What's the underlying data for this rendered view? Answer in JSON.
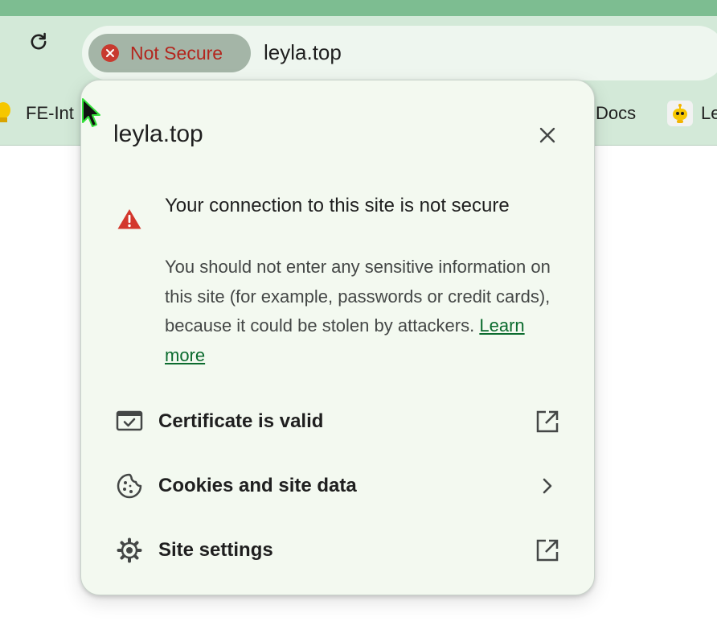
{
  "browser": {
    "reload_icon": "reload-icon",
    "security_chip": {
      "label": "Not Secure",
      "icon": "not-secure-icon",
      "color": "#b3261e"
    },
    "url": "leyla.top",
    "accent": "#7dbd91"
  },
  "bookmarks": {
    "items": [
      {
        "label": "FE-Int",
        "icon": "lightbulb-icon"
      },
      {
        "label": "Docs"
      },
      {
        "label": "Le",
        "icon": "robot-icon"
      }
    ]
  },
  "site_info_popup": {
    "title": "leyla.top",
    "close_icon": "close-icon",
    "warning": {
      "icon": "warning-icon",
      "heading": "Your connection to this site is not secure",
      "body": "You should not enter any sensitive information on this site (for example, passwords or credit cards), because it could be stolen by attackers.",
      "link": "Learn more"
    },
    "rows": [
      {
        "label": "Certificate is valid",
        "icon": "certificate-icon",
        "trailing_icon": "open-external-icon"
      },
      {
        "label": "Cookies and site data",
        "icon": "cookie-icon",
        "trailing_icon": "chevron-right-icon"
      },
      {
        "label": "Site settings",
        "icon": "gear-icon",
        "trailing_icon": "open-external-icon"
      }
    ]
  }
}
